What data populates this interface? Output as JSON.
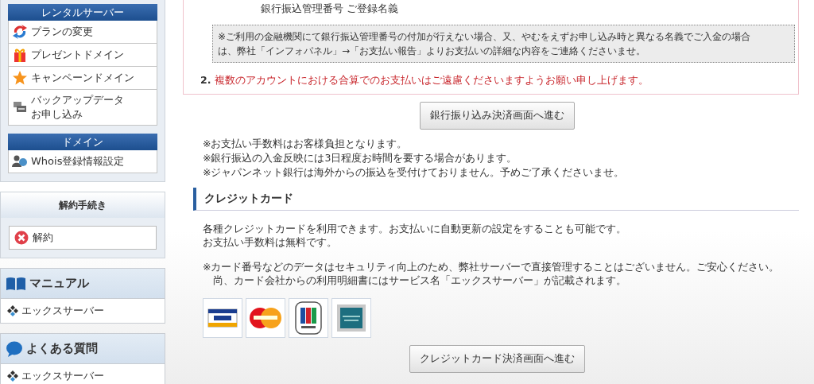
{
  "sidebar": [
    {
      "kind": "menu-box",
      "sections": [
        {
          "title": "レンタルサーバー",
          "items": [
            "プランの変更",
            "プレゼントドメイン",
            "キャンペーンドメイン",
            "バックアップデータお申し込み"
          ]
        },
        {
          "title": "ドメイン",
          "items": [
            "Whois登録情報設定"
          ]
        }
      ]
    },
    {
      "kind": "plain-box",
      "title": "解約手続き",
      "items": [
        "解約"
      ]
    },
    {
      "kind": "head-box",
      "title": "マニュアル",
      "items": [
        "エックスサーバー"
      ]
    },
    {
      "kind": "head-box",
      "title": "よくある質問",
      "items": [
        "エックスサーバー"
      ]
    }
  ],
  "bank": {
    "account_line": "銀行振込管理番号 ご登録名義",
    "note_lines": [
      "※ご利用の金融機関にて銀行振込管理番号の付加が行えない場合、又、やむをえずお申し込み時と異なる名義でご入金の場合",
      "は、弊社「インフォパネル」→「お支払い報告」よりお支払いの詳細な内容をご連絡くださいませ。"
    ],
    "list_item": {
      "number": "2.",
      "text": "複数のアカウントにおける合算でのお支払いはご遠慮くださいますようお願い申し上げます。"
    },
    "button": "銀行振り込み決済画面へ進む",
    "notes": [
      "※お支払い手数料はお客様負担となります。",
      "※銀行振込の入金反映には3日程度お時間を要する場合があります。",
      "※ジャパンネット銀行は海外からの振込を受付けておりません。予めご了承くださいませ。"
    ]
  },
  "credit": {
    "heading": "クレジットカード",
    "paragraphs": [
      [
        "各種クレジットカードを利用できます。お支払いに自動更新の設定をすることも可能です。",
        "お支払い手数料は無料です。"
      ],
      [
        "※カード番号などのデータはセキュリティ向上のため、弊社サーバーで直接管理することはございません。ご安心ください。",
        "　尚、カード会社からの利用明細書にはサービス名「エックスサーバー」が記載されます。"
      ]
    ],
    "button": "クレジットカード決済画面へ進む"
  }
}
